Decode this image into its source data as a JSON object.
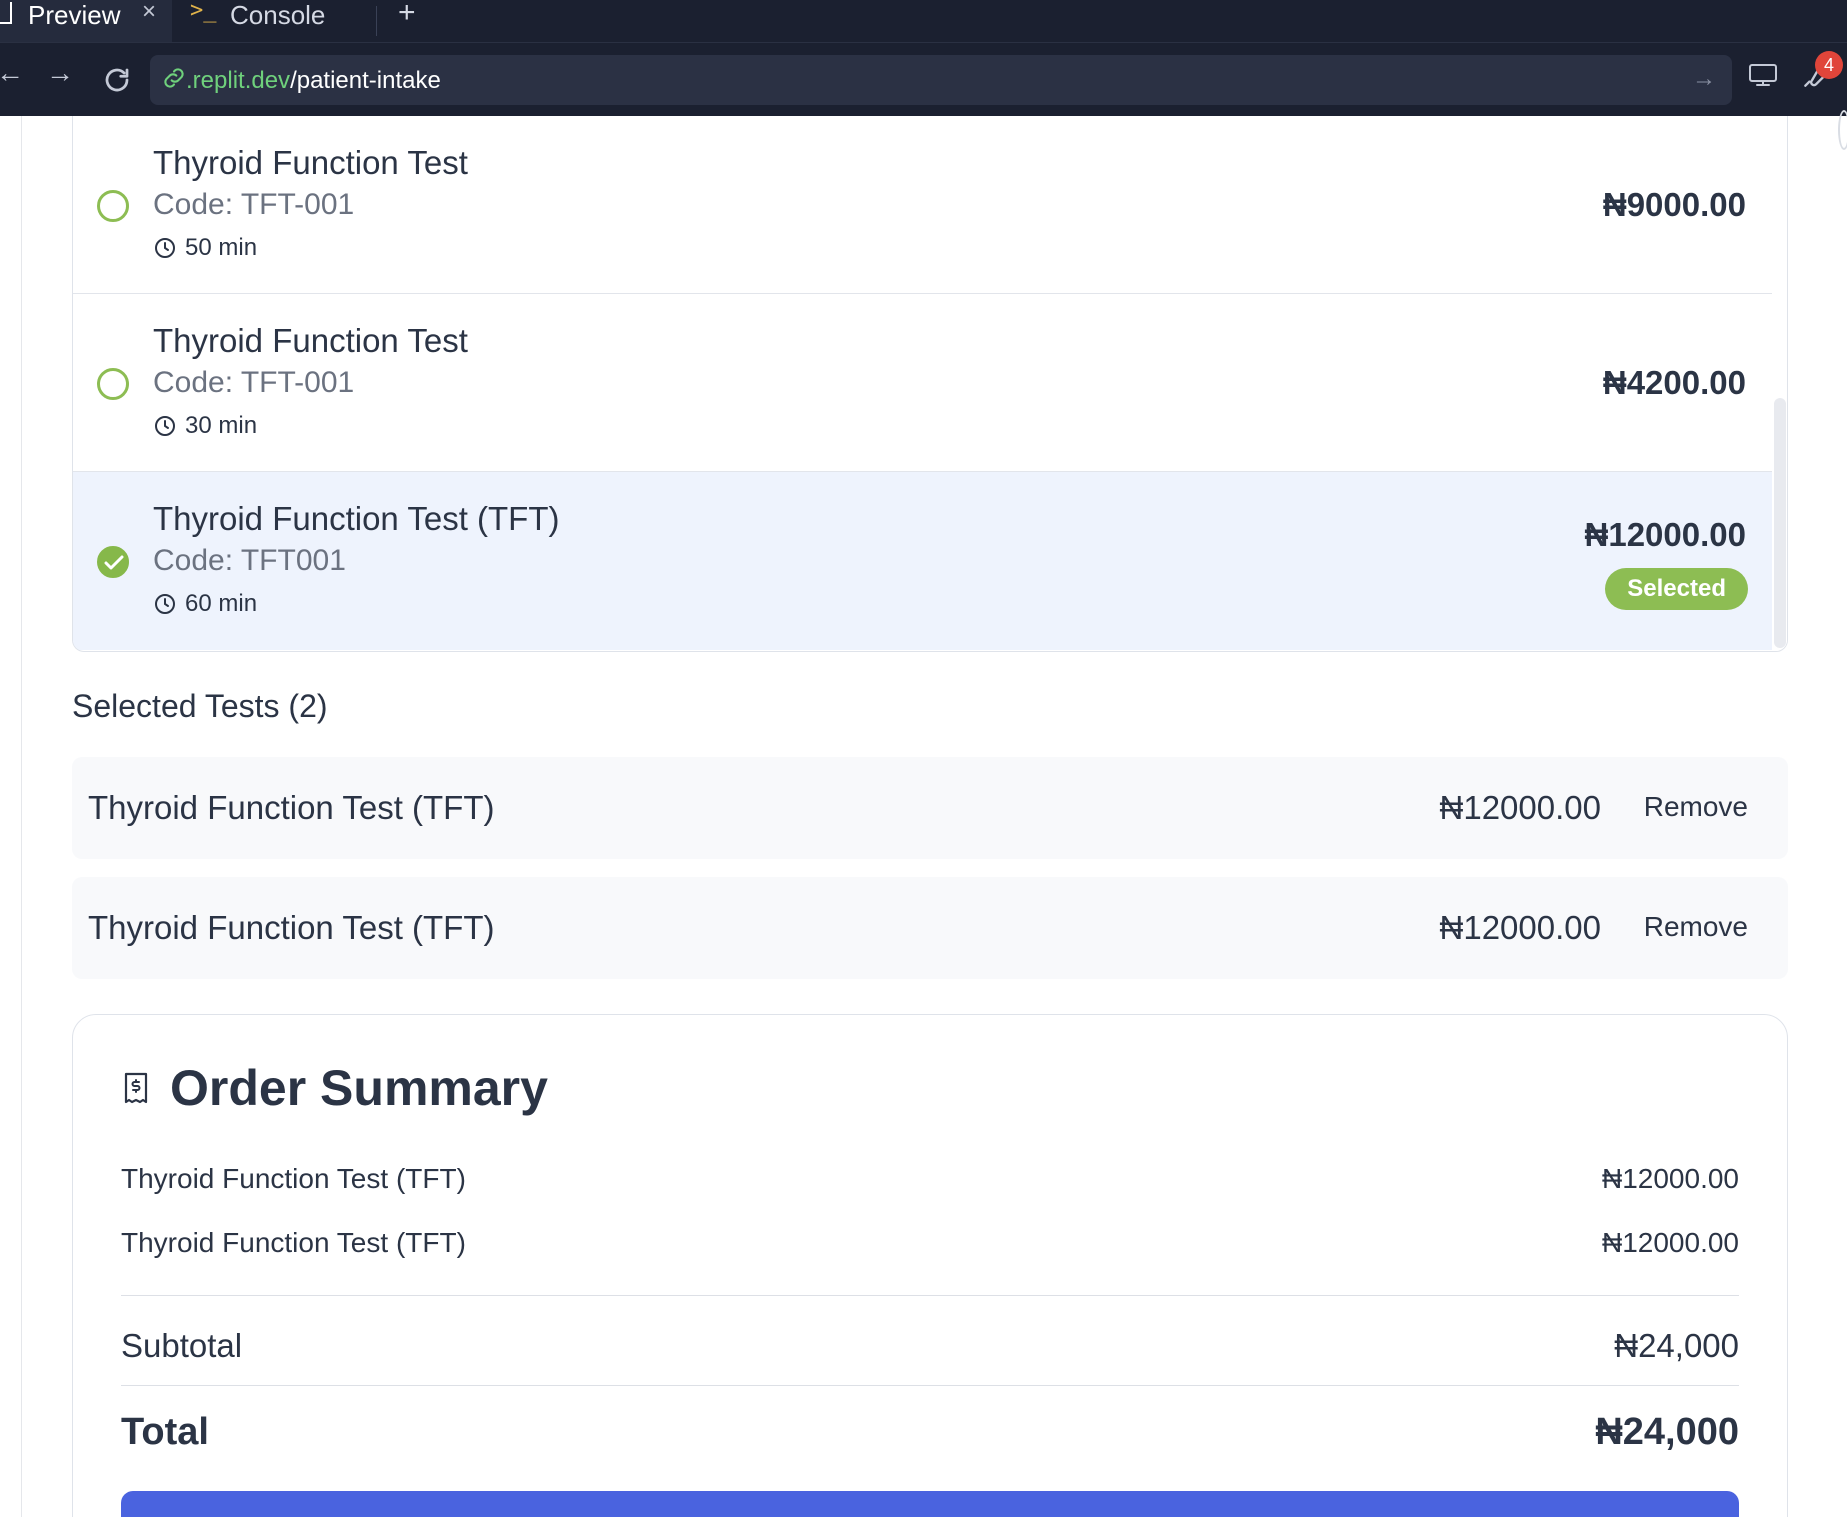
{
  "browser": {
    "tabs": [
      {
        "label": "Preview",
        "close": "×"
      },
      {
        "label": "Console",
        "prompt": ">_"
      }
    ],
    "new_tab": "+",
    "url_host": ".replit.dev",
    "url_path": "/patient-intake",
    "notification_count": "4",
    "nav": {
      "back": "←",
      "forward": "→",
      "go": "→"
    }
  },
  "test_list": [
    {
      "name": "Thyroid Function Test",
      "code": "Code: TFT-001",
      "duration": "50 min",
      "price": "₦9000.00",
      "selected": false
    },
    {
      "name": "Thyroid Function Test",
      "code": "Code: TFT-001",
      "duration": "30 min",
      "price": "₦4200.00",
      "selected": false
    },
    {
      "name": "Thyroid Function Test (TFT)",
      "code": "Code: TFT001",
      "duration": "60 min",
      "price": "₦12000.00",
      "selected": true,
      "badge": "Selected"
    }
  ],
  "selected_tests": {
    "heading": "Selected Tests (2)",
    "remove_label": "Remove",
    "items": [
      {
        "name": "Thyroid Function Test (TFT)",
        "price": "₦12000.00"
      },
      {
        "name": "Thyroid Function Test (TFT)",
        "price": "₦12000.00"
      }
    ]
  },
  "order_summary": {
    "title": "Order Summary",
    "lines": [
      {
        "name": "Thyroid Function Test (TFT)",
        "price": "₦12000.00"
      },
      {
        "name": "Thyroid Function Test (TFT)",
        "price": "₦12000.00"
      }
    ],
    "subtotal_label": "Subtotal",
    "subtotal_value": "₦24,000",
    "total_label": "Total",
    "total_value": "₦24,000"
  },
  "colors": {
    "accent_green": "#8dbd53",
    "button_blue": "#4a63df",
    "selected_bg": "#eef3fd",
    "chrome_bg": "#1b2030"
  }
}
